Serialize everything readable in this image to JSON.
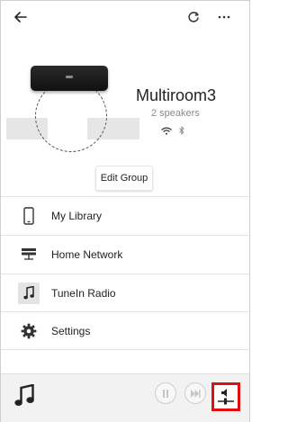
{
  "device": {
    "group_name": "Multiroom3",
    "speaker_count_label": "2 speakers",
    "edit_group_label": "Edit Group"
  },
  "menu": {
    "items": [
      {
        "label": "My Library",
        "icon": "phone-icon"
      },
      {
        "label": "Home Network",
        "icon": "network-server-icon"
      },
      {
        "label": "TuneIn Radio",
        "icon": "music-note-icon"
      },
      {
        "label": "Settings",
        "icon": "gear-icon"
      }
    ]
  },
  "player": {
    "controls": [
      "pause-icon",
      "skip-next-icon",
      "volume-settings-icon"
    ]
  },
  "colors": {
    "highlight": "#e01010",
    "player_bg": "#f2f2f2"
  }
}
